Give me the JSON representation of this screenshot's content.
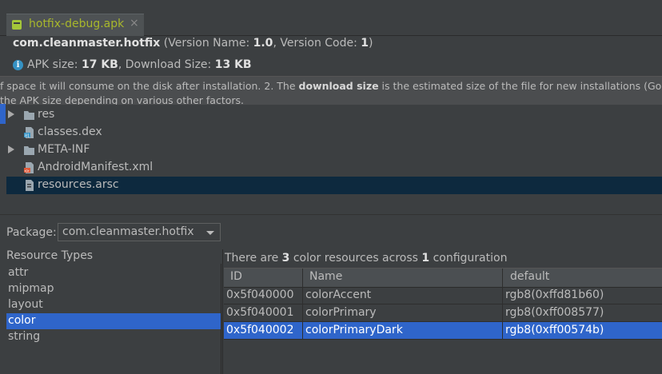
{
  "tab": {
    "title": "hotfix-debug.apk",
    "close": "×"
  },
  "header": {
    "package": "com.cleanmaster.hotfix",
    "version_prefix": " (Version Name: ",
    "version_name": "1.0",
    "version_mid": ", Version Code: ",
    "version_code": "1",
    "version_suffix": ")",
    "apk_size_label": "APK size: ",
    "apk_size": "17 KB",
    "download_label": ", Download Size: ",
    "download_size": "13 KB"
  },
  "tooltip": {
    "part1": "f space it will consume on the disk after installation. 2. The ",
    "bold": "download size",
    "part2": " is the estimated size of the file for new installations (Google Play se",
    "line2": "the APK size depending on various other factors."
  },
  "tree": {
    "items": [
      {
        "label": "res",
        "icon": "folder-icon",
        "expandable": true
      },
      {
        "label": "classes.dex",
        "icon": "dex-file-icon",
        "expandable": false
      },
      {
        "label": "META-INF",
        "icon": "folder-icon",
        "expandable": true
      },
      {
        "label": "AndroidManifest.xml",
        "icon": "xml-file-icon",
        "expandable": false
      },
      {
        "label": "resources.arsc",
        "icon": "arsc-file-icon",
        "expandable": false,
        "selected": true
      }
    ]
  },
  "package": {
    "label": "Package:",
    "value": "com.cleanmaster.hotfix"
  },
  "resource_types": {
    "header": "Resource Types",
    "items": [
      "attr",
      "mipmap",
      "layout",
      "color",
      "string"
    ],
    "selected": "color"
  },
  "summary": {
    "prefix": "There are ",
    "count": "3",
    "mid": " color resources across ",
    "configs": "1",
    "suffix": " configuration"
  },
  "table": {
    "columns": [
      "ID",
      "Name",
      "default"
    ],
    "rows": [
      {
        "id": "0x5f040000",
        "name": "colorAccent",
        "default": "rgb8(0xffd81b60)"
      },
      {
        "id": "0x5f040001",
        "name": "colorPrimary",
        "default": "rgb8(0xff008577)"
      },
      {
        "id": "0x5f040002",
        "name": "colorPrimaryDark",
        "default": "rgb8(0xff00574b)",
        "selected": true
      }
    ]
  },
  "colors": {
    "background": "#3c3f41",
    "selection": "#2f65ca",
    "tree_selection": "#0d293e",
    "tab_title": "#a8b72c",
    "info_icon": "#3592c4"
  }
}
